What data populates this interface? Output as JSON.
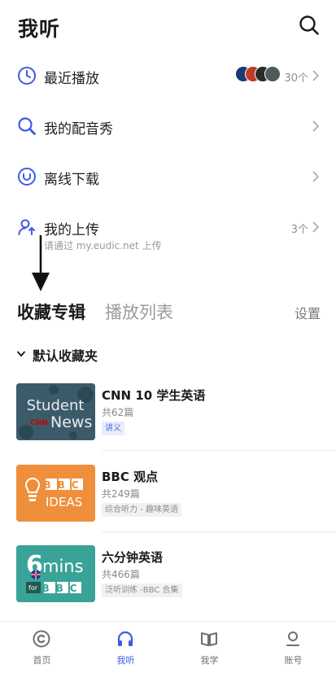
{
  "header": {
    "title": "我听",
    "search_icon": "search-icon"
  },
  "menu": [
    {
      "label": "最近播放",
      "count": "30个",
      "icon": "clock-icon"
    },
    {
      "label": "我的配音秀",
      "icon": "search-mic-icon"
    },
    {
      "label": "离线下载",
      "icon": "download-icon"
    },
    {
      "label": "我的上传",
      "count": "3个",
      "sub": "请通过 my.eudic.net 上传",
      "icon": "upload-user-icon"
    }
  ],
  "tabs": {
    "active": "收藏专辑",
    "inactive": "播放列表",
    "settings": "设置"
  },
  "folder": {
    "label": "默认收藏夹"
  },
  "albums": [
    {
      "name": "CNN 10 学生英语",
      "episodes": "共62篇",
      "tag": "讲义",
      "cover_text_1": "Student",
      "cover_text_2": "CNN",
      "cover_text_3": "News"
    },
    {
      "name": "BBC 观点",
      "episodes": "共249篇",
      "tag": "综合听力 - 趣味英语",
      "cover_text_1": "BBC",
      "cover_text_2": "IDEAS"
    },
    {
      "name": "六分钟英语",
      "episodes": "共466篇",
      "tag": "泛听训练 -BBC 合集",
      "cover_text_1": "6",
      "cover_text_2": "mins",
      "cover_text_3": "for",
      "cover_text_4": "BBC"
    }
  ],
  "nav": [
    {
      "label": "首页",
      "icon": "home-icon"
    },
    {
      "label": "我听",
      "icon": "headphones-icon",
      "active": true
    },
    {
      "label": "我学",
      "icon": "book-icon"
    },
    {
      "label": "账号",
      "icon": "account-icon"
    }
  ],
  "colors": {
    "accent": "#3d5ae6",
    "text": "#1f1f1f",
    "muted": "#9a9a9a"
  }
}
